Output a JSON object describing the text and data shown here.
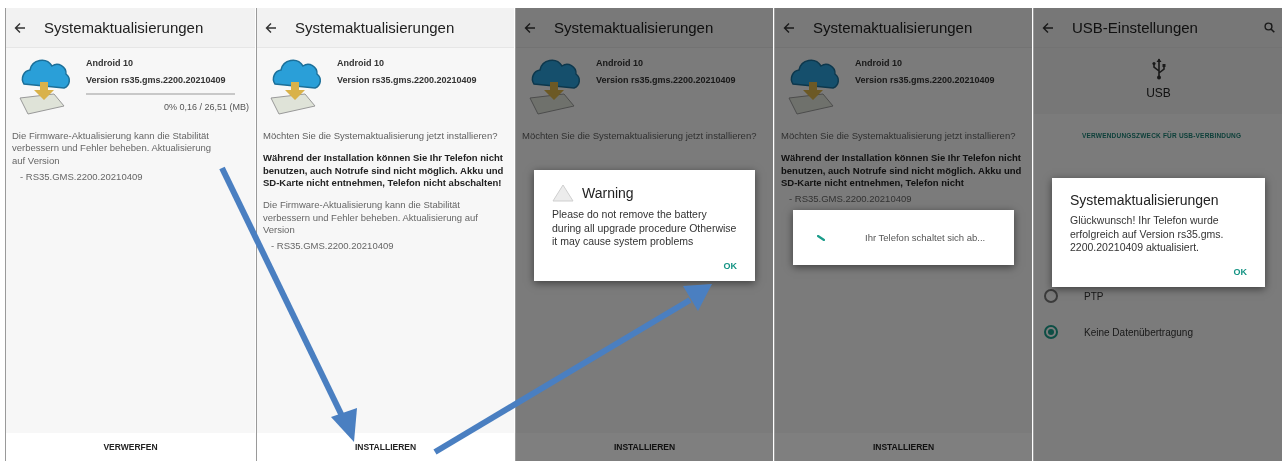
{
  "screens": [
    {
      "kind": "update",
      "dimmed": false,
      "app_bar": {
        "title": "Systemaktualisierungen"
      },
      "update": {
        "os": "Android 10",
        "version": "Version rs35.gms.2200.20210409",
        "progress": {
          "level": 0,
          "reading": "0% 0,16 / 26,51 (MB)"
        }
      },
      "paragraphs": [
        {
          "text": "Die Firmware-Aktualisierung kann die Stabilität verbessern und Fehler beheben. Aktualisierung auf Version",
          "kind": "normal"
        }
      ],
      "version_item": "- RS35.GMS.2200.20210409",
      "action": "VERWERFEN"
    },
    {
      "kind": "update",
      "dimmed": false,
      "app_bar": {
        "title": "Systemaktualisierungen"
      },
      "update": {
        "os": "Android 10",
        "version": "Version rs35.gms.2200.20210409"
      },
      "paragraphs": [
        {
          "text": "Möchten Sie die Systemaktualisierung jetzt installieren?",
          "kind": "muted"
        },
        {
          "text": "Während der Installation können Sie Ihr Telefon nicht benutzen, auch Notrufe sind nicht möglich. Akku und SD-Karte nicht entnehmen, Telefon nicht abschalten!",
          "kind": "strong"
        },
        {
          "text": "Die Firmware-Aktualisierung kann die Stabilität verbessern und Fehler beheben. Aktualisierung auf Version",
          "kind": "normal"
        }
      ],
      "version_item": "- RS35.GMS.2200.20210409",
      "action": "INSTALLIEREN"
    },
    {
      "kind": "update",
      "dimmed": true,
      "app_bar": {
        "title": "Systemaktualisierungen"
      },
      "update": {
        "os": "Android 10",
        "version": "Version rs35.gms.2200.20210409"
      },
      "paragraphs": [
        {
          "text": "Möchten Sie die Systemaktualisierung jetzt installieren?",
          "kind": "muted"
        }
      ],
      "action": "INSTALLIEREN",
      "dialog": {
        "kind": "alert",
        "title": "Warning",
        "message": "Please do not remove the battery during all upgrade procedure Otherwise it may cause system problems",
        "button": "OK"
      }
    },
    {
      "kind": "update",
      "dimmed": true,
      "app_bar": {
        "title": "Systemaktualisierungen"
      },
      "update": {
        "os": "Android 10",
        "version": "Version rs35.gms.2200.20210409"
      },
      "paragraphs": [
        {
          "text": "Möchten Sie die Systemaktualisierung jetzt installieren?",
          "kind": "muted"
        },
        {
          "text": "Während der Installation können Sie Ihr Telefon nicht benutzen, auch Notrufe sind nicht möglich. Akku und SD-Karte nicht entnehmen, Telefon nicht",
          "kind": "strong"
        }
      ],
      "version_item": "- RS35.GMS.2200.20210409",
      "action": "INSTALLIEREN",
      "dialog": {
        "kind": "progress",
        "message": "Ihr Telefon schaltet sich ab..."
      }
    },
    {
      "kind": "usb",
      "dimmed": true,
      "app_bar": {
        "title": "USB-Einstellungen"
      },
      "header": "USB",
      "section": "VERWENDUNGSZWECK FÜR USB-VERBINDUNG",
      "options": [
        {
          "label": "PTP",
          "selected": false
        },
        {
          "label": "Keine Datenübertragung",
          "selected": true
        }
      ],
      "dialog": {
        "kind": "message",
        "title": "Systemaktualisierungen",
        "message": "Glückwunsch! Ihr Telefon wurde erfolgreich auf Version rs35.gms. 2200.20210409 aktualisiert.",
        "button": "OK"
      }
    }
  ]
}
